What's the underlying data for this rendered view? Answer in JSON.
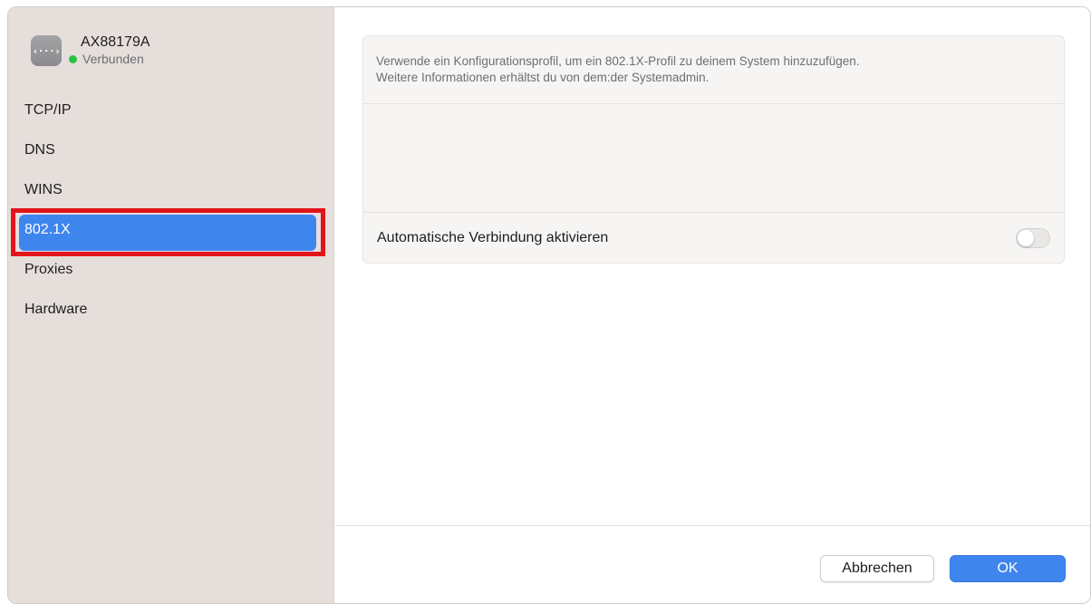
{
  "device": {
    "icon": "ethernet-icon",
    "icon_glyph": "‹···›",
    "name": "AX88179A",
    "status": "Verbunden",
    "status_color": "#29c23f"
  },
  "sidebar": {
    "items": [
      {
        "label": "TCP/IP"
      },
      {
        "label": "DNS"
      },
      {
        "label": "WINS"
      },
      {
        "label": "802.1X",
        "selected": true
      },
      {
        "label": "Proxies"
      },
      {
        "label": "Hardware"
      }
    ]
  },
  "main": {
    "info_line1": "Verwende ein Konfigurationsprofil, um ein 802.1X-Profil zu deinem System hinzuzufügen.",
    "info_line2": "Weitere Informationen erhältst du von dem:der Systemadmin.",
    "auto_connect_label": "Automatische Verbindung aktivieren",
    "auto_connect_enabled": false
  },
  "footer": {
    "cancel_label": "Abbrechen",
    "ok_label": "OK"
  },
  "colors": {
    "accent": "#3f85ee",
    "highlight": "#e1141a"
  }
}
